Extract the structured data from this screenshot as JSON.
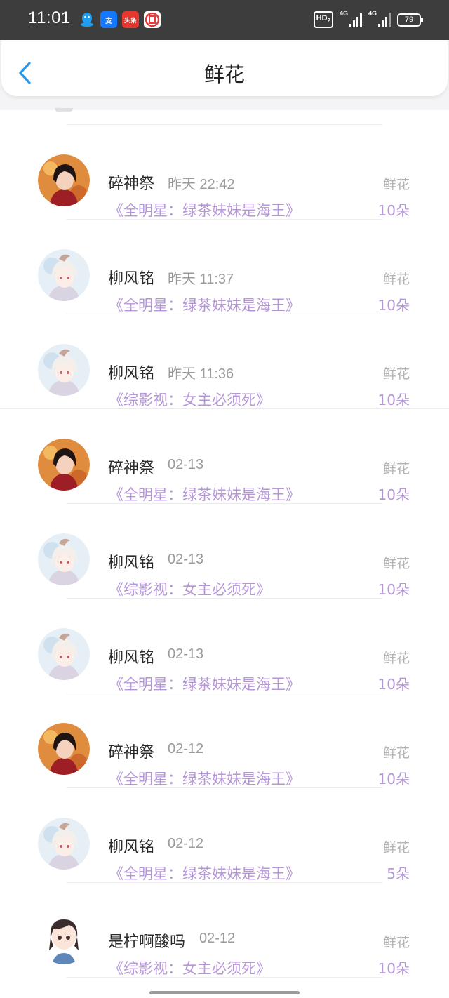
{
  "status_bar": {
    "time": "11:01",
    "apps": [
      {
        "icon": "qq-icon",
        "color": "#1e9df2"
      },
      {
        "icon": "alipay-icon",
        "color": "#1677ff",
        "text": "支"
      },
      {
        "icon": "toutiao-icon",
        "color": "#e8372f",
        "text": "头条"
      },
      {
        "icon": "bank-icon",
        "color": "#e83a3a",
        "text": "M"
      }
    ],
    "hd": "HD",
    "signal_1": "4G",
    "signal_2": "4G",
    "battery": "79"
  },
  "header": {
    "title": "鲜花"
  },
  "entries": [
    {
      "name": "碎神祭",
      "time": "昨天 22:42",
      "book": "《全明星：绿茶妹妹是海王》",
      "kind": "鲜花",
      "amount": "10朵",
      "avatar": "boy"
    },
    {
      "name": "柳风铭",
      "time": "昨天 11:37",
      "book": "《全明星：绿茶妹妹是海王》",
      "kind": "鲜花",
      "amount": "10朵",
      "avatar": "girl"
    },
    {
      "name": "柳风铭",
      "time": "昨天 11:36",
      "book": "《综影视：女主必须死》",
      "kind": "鲜花",
      "amount": "10朵",
      "avatar": "girl"
    },
    {
      "name": "碎神祭",
      "time": "02-13",
      "book": "《全明星：绿茶妹妹是海王》",
      "kind": "鲜花",
      "amount": "10朵",
      "avatar": "boy"
    },
    {
      "name": "柳风铭",
      "time": "02-13",
      "book": "《综影视：女主必须死》",
      "kind": "鲜花",
      "amount": "10朵",
      "avatar": "girl"
    },
    {
      "name": "柳风铭",
      "time": "02-13",
      "book": "《全明星：绿茶妹妹是海王》",
      "kind": "鲜花",
      "amount": "10朵",
      "avatar": "girl"
    },
    {
      "name": "碎神祭",
      "time": "02-12",
      "book": "《全明星：绿茶妹妹是海王》",
      "kind": "鲜花",
      "amount": "10朵",
      "avatar": "boy"
    },
    {
      "name": "柳风铭",
      "time": "02-12",
      "book": "《全明星：绿茶妹妹是海王》",
      "kind": "鲜花",
      "amount": "5朵",
      "avatar": "girl"
    },
    {
      "name": "是柠啊酸吗",
      "time": "02-12",
      "book": "《综影视：女主必须死》",
      "kind": "鲜花",
      "amount": "10朵",
      "avatar": "chibi"
    }
  ]
}
